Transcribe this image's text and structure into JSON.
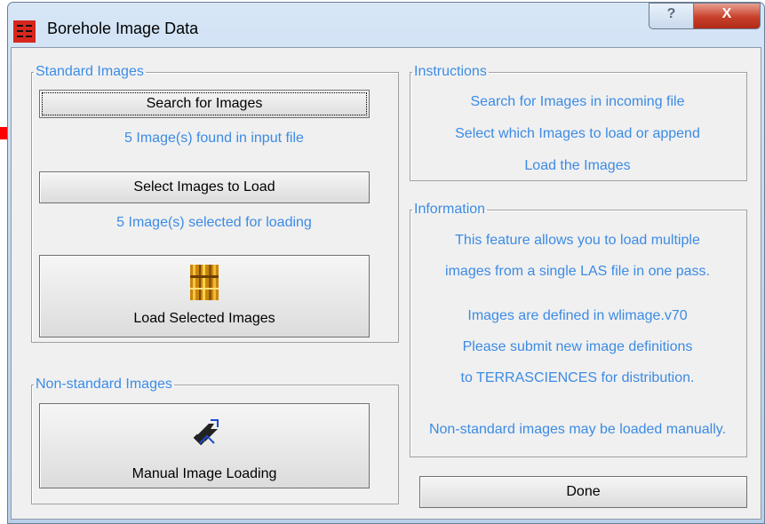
{
  "window": {
    "title": "Borehole Image Data",
    "help_glyph": "?",
    "close_glyph": "X"
  },
  "standard": {
    "legend": "Standard Images",
    "search_button": "Search for Images",
    "found_text": "5 Image(s) found in input file",
    "select_button": "Select Images to Load",
    "selected_text": "5 Image(s) selected for loading",
    "load_button": "Load Selected Images"
  },
  "nonstandard": {
    "legend": "Non-standard Images",
    "manual_button": "Manual Image Loading"
  },
  "instructions": {
    "legend": "Instructions",
    "lines": [
      "Search for Images in incoming file",
      "Select which Images to load or append",
      "Load the Images"
    ]
  },
  "information": {
    "legend": "Information",
    "lines": [
      "This feature allows you to load multiple",
      "images from a single LAS file in one pass.",
      "Images are defined in wlimage.v70",
      "Please submit new image definitions",
      "to TERRASCIENCES for distribution.",
      "Non-standard images may be loaded manually."
    ]
  },
  "done_button": "Done",
  "colors": {
    "accent_text": "#3c8be4",
    "arrow": "#ff0000",
    "title_bar": "#c3d8ef"
  },
  "icons": {
    "app": "terrasciences-logo-icon",
    "load": "borehole-images-icon",
    "manual": "tools-icon",
    "pointer": "red-arrow-icon"
  }
}
